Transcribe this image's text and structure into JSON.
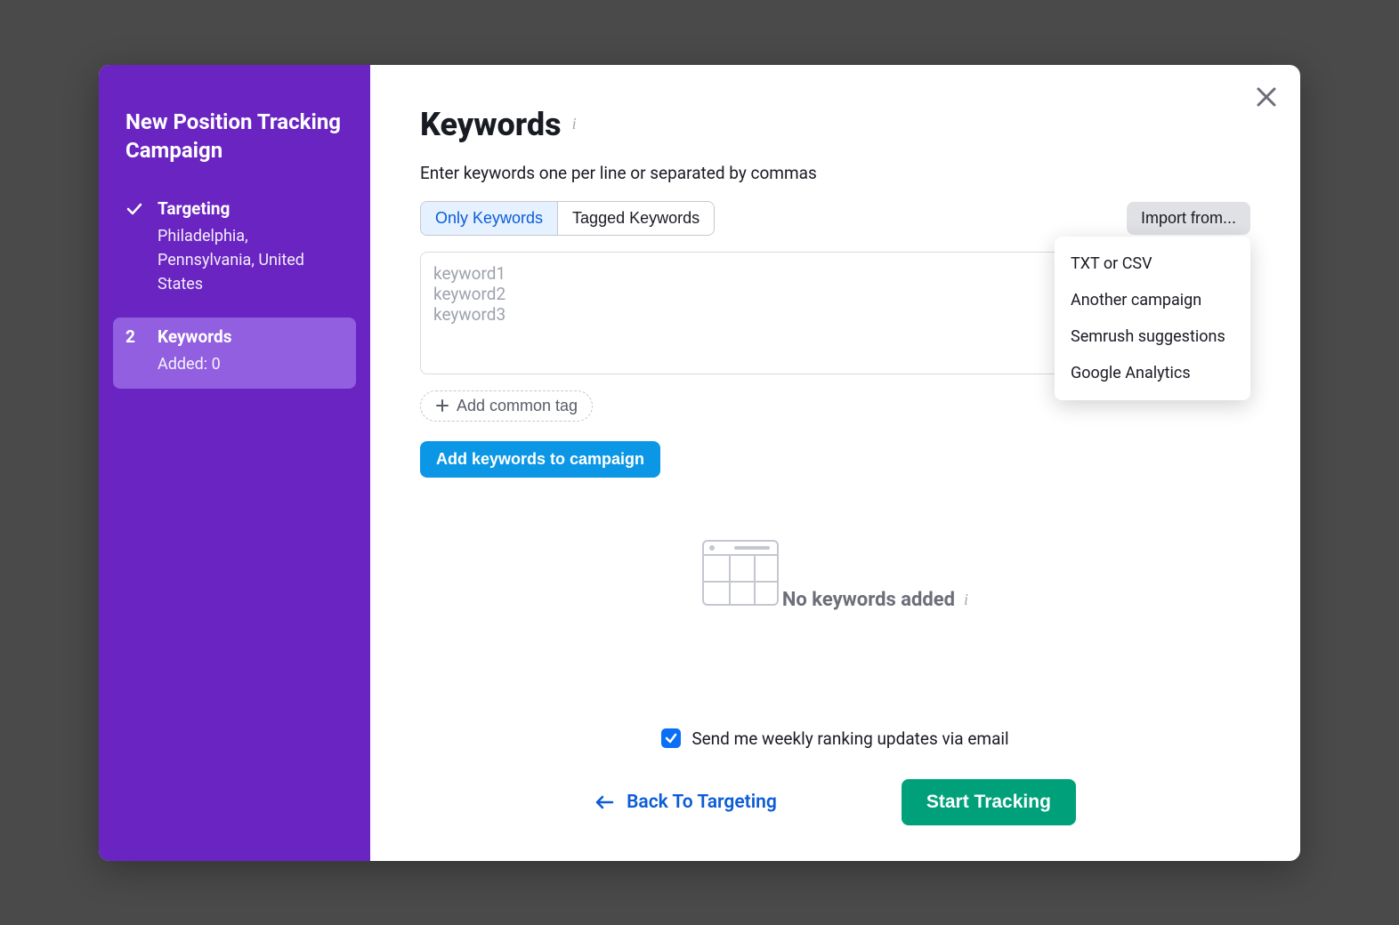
{
  "sidebar": {
    "title": "New Position Tracking Campaign",
    "steps": [
      {
        "label": "Targeting",
        "sub": "Philadelphia, Pennsylvania, United States"
      },
      {
        "number": "2",
        "label": "Keywords",
        "sub": "Added: 0"
      }
    ]
  },
  "main": {
    "title": "Keywords",
    "subtitle": "Enter keywords one per line or separated by commas",
    "tabs": {
      "only": "Only Keywords",
      "tagged": "Tagged Keywords"
    },
    "import_label": "Import from...",
    "import_options": [
      "TXT or CSV",
      "Another campaign",
      "Semrush suggestions",
      "Google Analytics"
    ],
    "placeholder": "keyword1\nkeyword2\nkeyword3",
    "add_tag": "Add common tag",
    "add_keywords": "Add keywords to campaign",
    "empty": "No keywords added",
    "checkbox_label": "Send me weekly ranking updates via email",
    "back": "Back To Targeting",
    "start": "Start Tracking"
  }
}
